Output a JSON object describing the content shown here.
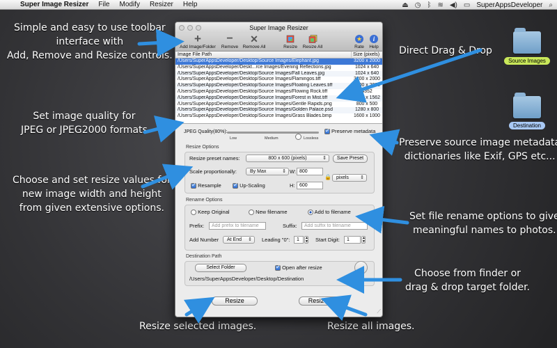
{
  "menubar": {
    "app_name": "Super Image Resizer",
    "items": [
      "File",
      "Modify",
      "Resizer",
      "Help"
    ],
    "user": "SuperAppsDeveloper"
  },
  "window": {
    "title": "Super Image Resizer",
    "toolbar": {
      "add_label": "Add Image/Folder",
      "remove_label": "Remove",
      "remove_all_label": "Remove All",
      "resize_label": "Resize",
      "resize_all_label": "Resize All",
      "rate_label": "Rate",
      "help_label": "Help"
    },
    "list": {
      "col_path": "Image File Path",
      "col_size": "Size (pixels)",
      "rows": [
        {
          "path": "/Users/SuperAppsDeveloper/Desktop/Source Images/Elephant.jpg",
          "size": "3200 x 2000"
        },
        {
          "path": "/Users/SuperAppsDeveloper/Deskt...rce Images/Evening Reflections.jpg",
          "size": "1024 x 640"
        },
        {
          "path": "/Users/SuperAppsDeveloper/Desktop/Source Images/Fall Leaves.jpg",
          "size": "1024 x 640"
        },
        {
          "path": "/Users/SuperAppsDeveloper/Desktop/Source Images/Flamingos.tiff",
          "size": "3200 x 2000"
        },
        {
          "path": "/Users/SuperAppsDeveloper/Desktop/Source Images/Floating Leaves.tiff",
          "size": "3200 x 2000"
        },
        {
          "path": "/Users/SuperAppsDeveloper/Desktop/Source Images/Flowing Rock.tiff",
          "size": "4352"
        },
        {
          "path": "/Users/SuperAppsDeveloper/Desktop/Source Images/Forest in Mist.tiff",
          "size": "2500 x 1562"
        },
        {
          "path": "/Users/SuperAppsDeveloper/Desktop/Source Images/Gentle Rapids.png",
          "size": "800 x 500"
        },
        {
          "path": "/Users/SuperAppsDeveloper/Desktop/Source Images/Golden Palace.psd",
          "size": "1280 x 800"
        },
        {
          "path": "/Users/SuperAppsDeveloper/Desktop/Source Images/Grass Blades.bmp",
          "size": "1600 x 1000"
        }
      ]
    },
    "quality": {
      "label": "JPEG Quality(80%):",
      "value_percent": 80,
      "tick_low": "Low",
      "tick_medium": "Medium",
      "tick_lossless": "Lossless",
      "preserve_label": "Preserve metadata"
    },
    "resize_options": {
      "title": "Resize Options",
      "preset_label": "Resize preset names:",
      "preset_value": "800 x 600 (pixels)",
      "save_preset": "Save Preset",
      "scale_label": "Scale proportionally:",
      "scale_value": "By Max",
      "w_label": "W:",
      "w_value": "800",
      "h_label": "H:",
      "h_value": "600",
      "unit_value": "pixels",
      "resample_label": "Resample",
      "upscaling_label": "Up-Scaling"
    },
    "rename_options": {
      "title": "Rename Options",
      "keep_label": "Keep Original",
      "new_label": "New filename",
      "add_label": "Add to filename",
      "prefix_label": "Prefix:",
      "prefix_placeholder": "Add prefix to filename",
      "suffix_label": "Suffix:",
      "suffix_placeholder": "Add suffix to filename",
      "add_number_label": "Add Number",
      "add_number_value": "At End",
      "leading_label": "Leading \"0\":",
      "leading_value": "1",
      "start_label": "Start Digit:",
      "start_value": "1"
    },
    "destination": {
      "title": "Destination Path",
      "select_button": "Select Folder",
      "open_after_label": "Open after resize",
      "path": "/Users/SuperAppsDeveloper/Desktop/Destination"
    },
    "resize_button": "Resize",
    "resize_all_button": "Resize All"
  },
  "desktop": {
    "source_folder": "Source Images",
    "destination_folder": "Destination"
  },
  "annotations": {
    "toolbar": [
      "Simple and easy to use toolbar",
      "interface with",
      "Add, Remove and Resize controls."
    ],
    "drag_drop": "Direct Drag & Drop",
    "quality": [
      "Set image quality for",
      "JPEG or JPEG2000 formats"
    ],
    "metadata": [
      "Preserve source image metadata",
      "dictionaries like Exif, GPS etc..."
    ],
    "resize_values": [
      "Choose and set resize values for",
      "new image width and height",
      "from given extensive options."
    ],
    "rename": [
      "Set file rename options to give",
      "meaningful names to photos."
    ],
    "destination": [
      "Choose from finder or",
      "drag & drop target folder."
    ],
    "resize_selected": "Resize selected images.",
    "resize_all": "Resize all images."
  },
  "colors": {
    "selection": "#3d78d6",
    "arrow": "#2f8fe0",
    "source_tag": "#c9e85a",
    "destination_tag": "#a9c9f5"
  }
}
